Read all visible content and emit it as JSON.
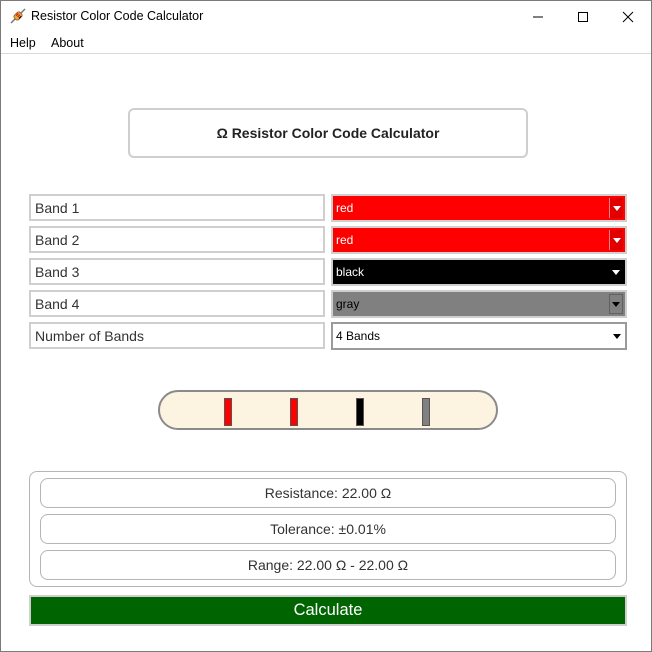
{
  "window": {
    "title": "Resistor Color Code Calculator",
    "icon": "resistor-icon"
  },
  "menu": {
    "items": [
      "Help",
      "About"
    ]
  },
  "header": {
    "title": "Ω Resistor Color Code Calculator"
  },
  "bands": [
    {
      "label": "Band 1",
      "selected": "red",
      "color": "#ff0000"
    },
    {
      "label": "Band 2",
      "selected": "red",
      "color": "#ff0000"
    },
    {
      "label": "Band 3",
      "selected": "black",
      "color": "#000000"
    },
    {
      "label": "Band 4",
      "selected": "gray",
      "color": "#808080"
    }
  ],
  "band_count": {
    "label": "Number of Bands",
    "selected": "4 Bands"
  },
  "resistor": {
    "body_color": "#fdf3e1",
    "stripes": [
      "#ff0000",
      "#ff0000",
      "#000000",
      "#808080"
    ]
  },
  "results": {
    "resistance": "Resistance: 22.00 Ω",
    "tolerance": "Tolerance: ±0.01%",
    "range": "Range: 22.00 Ω - 22.00 Ω"
  },
  "actions": {
    "calculate_label": "Calculate",
    "calculate_color": "#006400"
  }
}
